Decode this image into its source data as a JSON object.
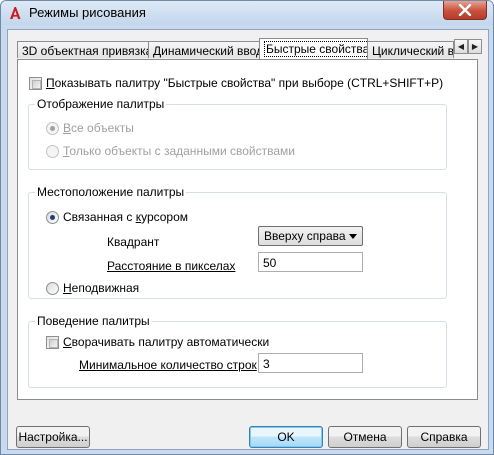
{
  "window": {
    "title": "Режимы рисования"
  },
  "tabs": [
    {
      "label": "3D объектная привязка",
      "active": false
    },
    {
      "label": "Динамический ввод",
      "active": false
    },
    {
      "label": "Быстрые свойства",
      "active": true
    },
    {
      "label": "Циклический в",
      "active": false
    }
  ],
  "show_palette": {
    "label_u": "П",
    "label_rest": "оказывать палитру \"Быстрые свойства\" при выборе (CTRL+SHIFT+P)",
    "checked": false
  },
  "display_group": {
    "title": "Отображение палитры",
    "all_objects": {
      "label_u": "В",
      "label_rest": "се объекты",
      "checked": true,
      "enabled": false
    },
    "defined_objects": {
      "label_u": "Т",
      "label_rest": "олько объекты с заданными свойствами",
      "checked": false,
      "enabled": false
    }
  },
  "location_group": {
    "title": "Местоположение палитры",
    "cursor": {
      "label_a": "Связанная с ",
      "label_u": "к",
      "label_b": "урсором",
      "checked": true
    },
    "quadrant": {
      "label": "Квадрант",
      "value": "Вверху справа"
    },
    "distance": {
      "label": "Расстояние в пикселах",
      "value": "50"
    },
    "static": {
      "label_u": "Н",
      "label_rest": "еподвижная",
      "checked": false
    }
  },
  "behavior_group": {
    "title": "Поведение палитры",
    "auto_collapse": {
      "label_u": "С",
      "label_rest": "ворачивать палитру автоматически",
      "checked": false
    },
    "min_rows": {
      "label": "Минимальное количество строк",
      "value": "3"
    }
  },
  "buttons": {
    "options": "Настройка...",
    "ok": "OK",
    "cancel": "Отмена",
    "help": "Справка"
  }
}
